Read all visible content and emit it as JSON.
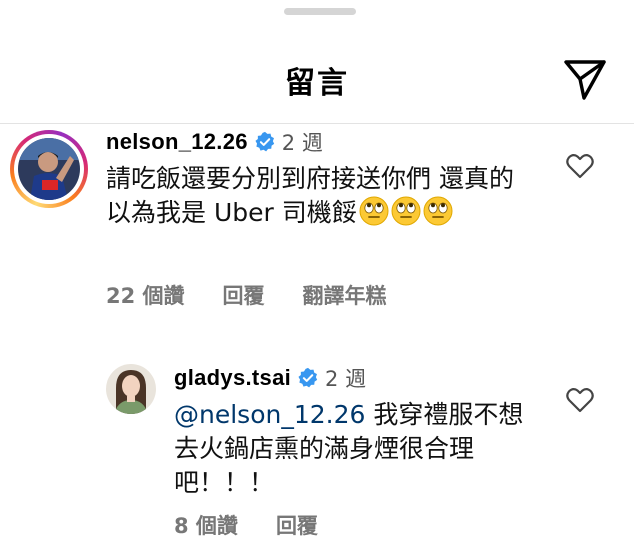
{
  "header": {
    "title": "留言",
    "share_icon": "paper-plane-icon"
  },
  "comment": {
    "username": "nelson_12.26",
    "time": "2 週",
    "text": "請吃飯還要分別到府接送你們 還真的以為我是 Uber 司機餒",
    "emojis": [
      "face-with-rolling-eyes",
      "face-with-rolling-eyes",
      "face-with-rolling-eyes"
    ],
    "likes": "22 個讚",
    "reply_label": "回覆",
    "translate_label": "翻譯年糕"
  },
  "reply": {
    "username": "gladys.tsai",
    "time": "2 週",
    "mention": "@nelson_12.26",
    "text": " 我穿禮服不想去火鍋店熏的滿身煙很合理吧！！！",
    "likes": "8 個讚",
    "reply_label": "回覆"
  },
  "colors": {
    "verified": "#3897f0",
    "mention": "#00376b",
    "secondary_text": "#777777"
  }
}
